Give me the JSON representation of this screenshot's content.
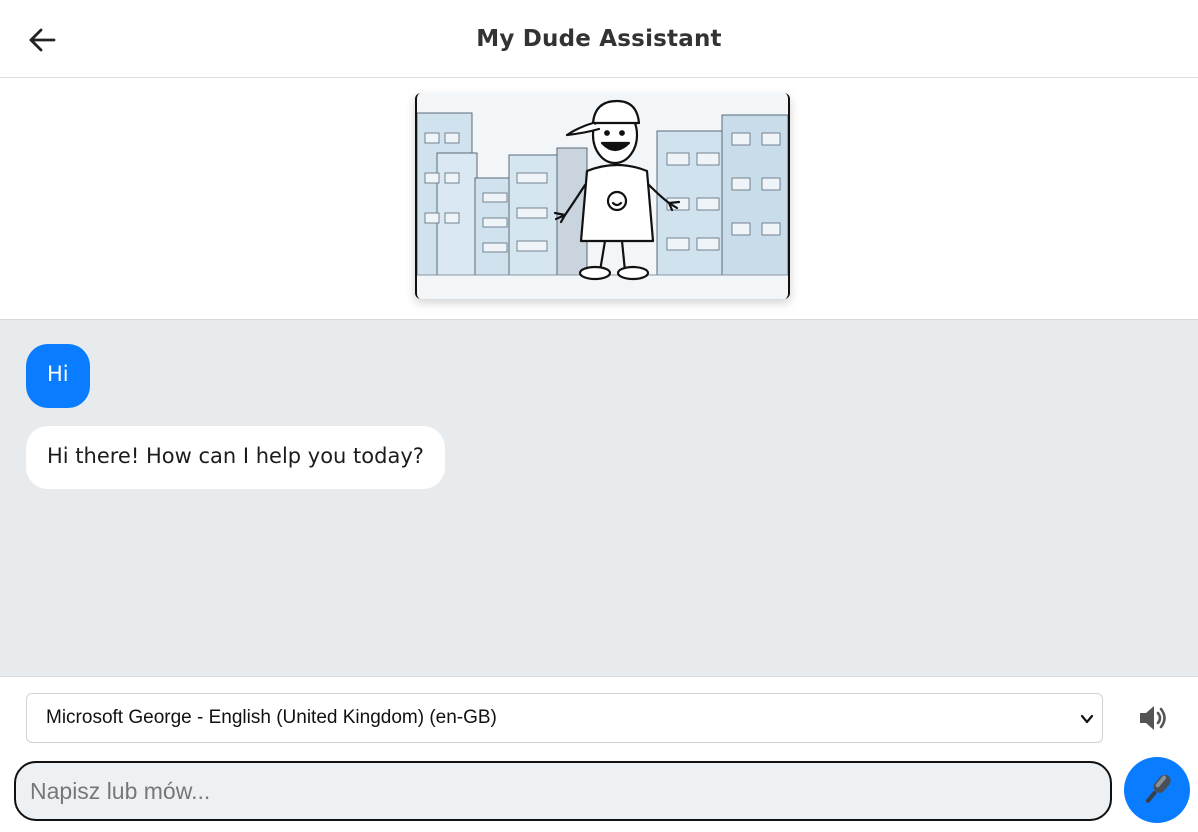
{
  "header": {
    "title": "My Dude Assistant",
    "back_icon": "arrow-left-icon"
  },
  "hero": {
    "image": "cartoon-dude-city-illustration"
  },
  "chat": {
    "messages": [
      {
        "role": "user",
        "text": "Hi"
      },
      {
        "role": "assistant",
        "text": "Hi there! How can I help you today?"
      }
    ]
  },
  "controls": {
    "voice_select": {
      "selected": "Microsoft George - English (United Kingdom) (en-GB)"
    },
    "speaker_icon": "speaker-icon",
    "input": {
      "value": "",
      "placeholder": "Napisz lub mów..."
    },
    "mic_icon": "microphone-icon"
  },
  "colors": {
    "accent": "#0a7cff",
    "chat_bg": "#e8ebee",
    "bot_bubble": "#ffffff"
  }
}
